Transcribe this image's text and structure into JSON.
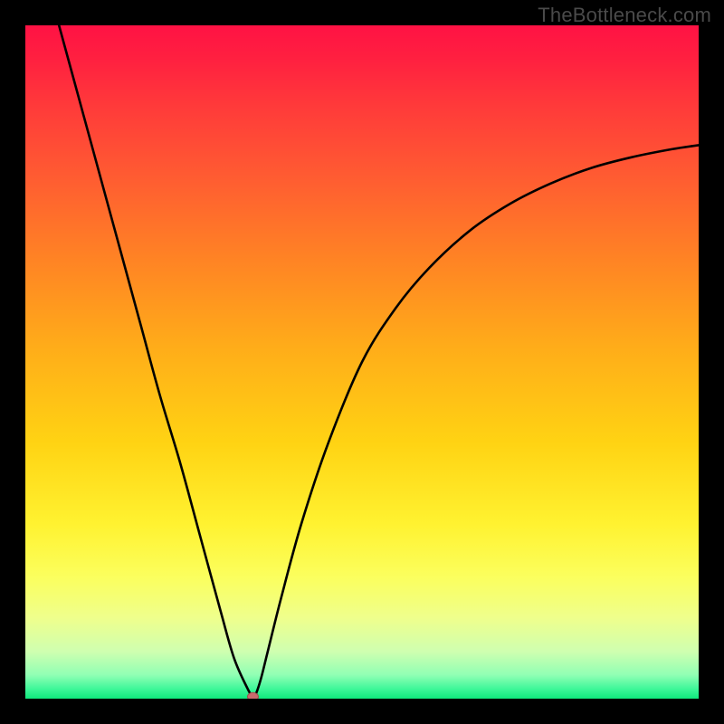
{
  "watermark": "TheBottleneck.com",
  "colors": {
    "frame": "#000000",
    "curve": "#000000",
    "marker_fill": "#c96b6d",
    "marker_stroke": "#a04d4f",
    "gradient_stops": [
      {
        "offset": 0.0,
        "color": "#ff1244"
      },
      {
        "offset": 0.05,
        "color": "#ff2040"
      },
      {
        "offset": 0.12,
        "color": "#ff3a3a"
      },
      {
        "offset": 0.22,
        "color": "#ff5a32"
      },
      {
        "offset": 0.35,
        "color": "#ff8424"
      },
      {
        "offset": 0.48,
        "color": "#ffad19"
      },
      {
        "offset": 0.62,
        "color": "#ffd313"
      },
      {
        "offset": 0.74,
        "color": "#fff230"
      },
      {
        "offset": 0.82,
        "color": "#fbff5e"
      },
      {
        "offset": 0.88,
        "color": "#efff8c"
      },
      {
        "offset": 0.93,
        "color": "#cfffb0"
      },
      {
        "offset": 0.965,
        "color": "#90ffb4"
      },
      {
        "offset": 0.985,
        "color": "#40f79a"
      },
      {
        "offset": 1.0,
        "color": "#10e87c"
      }
    ]
  },
  "chart_data": {
    "type": "line",
    "title": "",
    "xlabel": "",
    "ylabel": "",
    "xlim": [
      0,
      100
    ],
    "ylim": [
      0,
      100
    ],
    "series": [
      {
        "name": "bottleneck-curve",
        "x": [
          5,
          8,
          11,
          14,
          17,
          20,
          23,
          26,
          29,
          31,
          33,
          33.8,
          34.2,
          35,
          36,
          38,
          41,
          45,
          50,
          55,
          60,
          66,
          72,
          78,
          84,
          90,
          96,
          100
        ],
        "y": [
          100,
          89,
          78,
          67,
          56,
          45,
          35,
          24,
          13,
          6,
          1.5,
          0.3,
          0.6,
          3,
          7,
          15,
          26,
          38,
          50,
          58,
          64,
          69.5,
          73.5,
          76.5,
          78.8,
          80.4,
          81.6,
          82.2
        ]
      }
    ],
    "marker": {
      "x": 33.8,
      "y": 0.3
    },
    "annotations": []
  }
}
